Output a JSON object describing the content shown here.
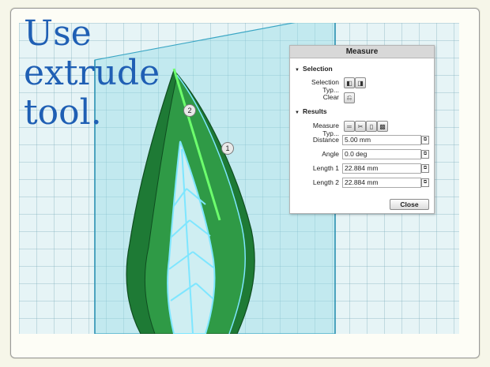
{
  "caption": {
    "line1": "Use",
    "line2": "extrude",
    "line3": "tool."
  },
  "markers": {
    "m1": "1",
    "m2": "2"
  },
  "measure_panel": {
    "title": "Measure",
    "selection_section": "Selection",
    "selection_type_label": "Selection Typ...",
    "clear_label": "Clear",
    "results_section": "Results",
    "measure_type_label": "Measure Typ...",
    "distance_label": "Distance",
    "distance_value": "5.00 mm",
    "angle_label": "Angle",
    "angle_value": "0.0 deg",
    "length1_label": "Length 1",
    "length1_value": "22.884 mm",
    "length2_label": "Length 2",
    "length2_value": "22.884 mm",
    "close_label": "Close"
  },
  "colors": {
    "caption": "#1f5fb4",
    "leaf_dark": "#1e7a35",
    "leaf_light": "#2f9a46",
    "highlight": "#7ee6ff"
  }
}
